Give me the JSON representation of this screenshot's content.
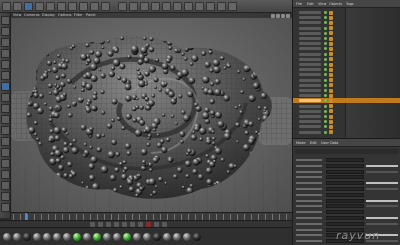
{
  "viewport": {
    "menu": [
      "View",
      "Cameras",
      "Display",
      "Options",
      "Filter",
      "Panel"
    ],
    "background_color": "#6b6b6b"
  },
  "object_manager": {
    "menu": [
      "File",
      "Edit",
      "View",
      "Objects",
      "Tags"
    ],
    "rows": 24,
    "selected_row_index": 17,
    "selected_color": "#c07a1e"
  },
  "attribute_manager": {
    "menu": [
      "Mode",
      "Edit",
      "User Data"
    ]
  },
  "materials": {
    "swatches": [
      "grey",
      "grey",
      "dark",
      "grey",
      "grey",
      "grey",
      "grey",
      "green",
      "grey",
      "green",
      "grey",
      "grey",
      "green",
      "grey",
      "grey",
      "dark",
      "grey",
      "grey",
      "grey",
      "dark"
    ]
  },
  "logo": {
    "text": "rayvun"
  },
  "icons": {
    "toolbar": [
      "undo-icon",
      "redo-icon",
      "select-icon",
      "move-icon",
      "scale-icon",
      "rotate-icon",
      "axis-x-icon",
      "axis-y-icon",
      "axis-z-icon",
      "coord-icon",
      "render-icon",
      "render-view-icon",
      "render-settings-icon",
      "cube-icon",
      "spline-icon",
      "nurbs-icon",
      "array-icon",
      "deformer-icon",
      "scene-icon",
      "camera-icon",
      "light-icon"
    ]
  },
  "colors": {
    "accent_blue": "#4a8bd1",
    "selection_orange": "#c07a1e",
    "panel_bg": "#333333"
  }
}
